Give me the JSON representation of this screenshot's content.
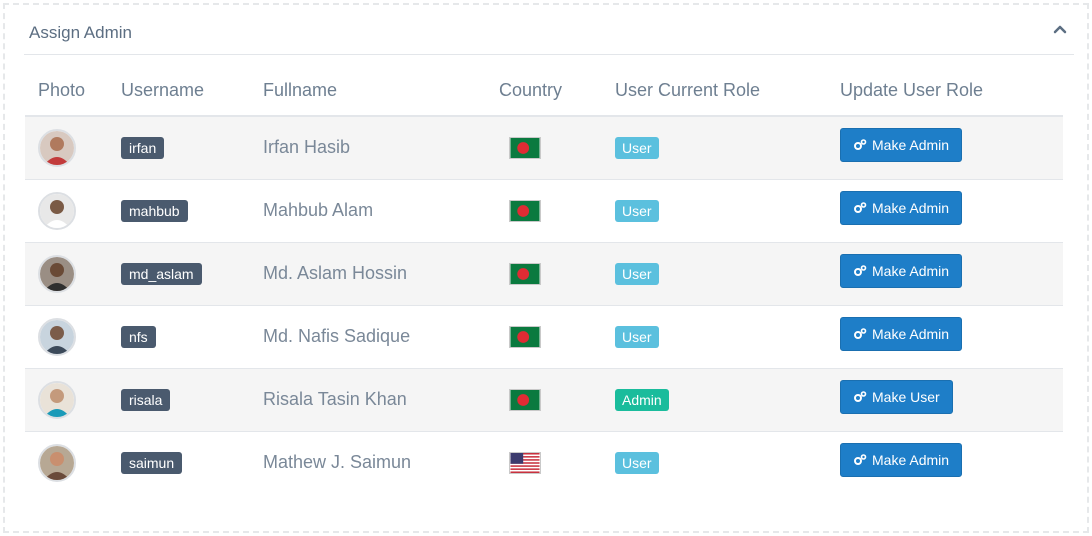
{
  "panel": {
    "title": "Assign Admin",
    "collapse_icon": "chevron-up-icon"
  },
  "table": {
    "headers": [
      "Photo",
      "Username",
      "Fullname",
      "Country",
      "User Current Role",
      "Update User Role"
    ],
    "rows": [
      {
        "username": "irfan",
        "fullname": "Irfan Hasib",
        "country_flag": "bangladesh-flag-icon",
        "role": "User",
        "action": "Make Admin"
      },
      {
        "username": "mahbub",
        "fullname": "Mahbub Alam",
        "country_flag": "bangladesh-flag-icon",
        "role": "User",
        "action": "Make Admin"
      },
      {
        "username": "md_aslam",
        "fullname": "Md. Aslam Hossin",
        "country_flag": "bangladesh-flag-icon",
        "role": "User",
        "action": "Make Admin"
      },
      {
        "username": "nfs",
        "fullname": "Md. Nafis Sadique",
        "country_flag": "bangladesh-flag-icon",
        "role": "User",
        "action": "Make Admin"
      },
      {
        "username": "risala",
        "fullname": "Risala Tasin Khan",
        "country_flag": "bangladesh-flag-icon",
        "role": "Admin",
        "action": "Make User"
      },
      {
        "username": "saimun",
        "fullname": "Mathew J. Saimun",
        "country_flag": "usa-flag-icon",
        "role": "User",
        "action": "Make Admin"
      }
    ]
  },
  "colors": {
    "user_badge": "#5bc0de",
    "admin_badge": "#1abc9c",
    "username_badge": "#4a5a6e",
    "action_button": "#1e7ec8"
  }
}
